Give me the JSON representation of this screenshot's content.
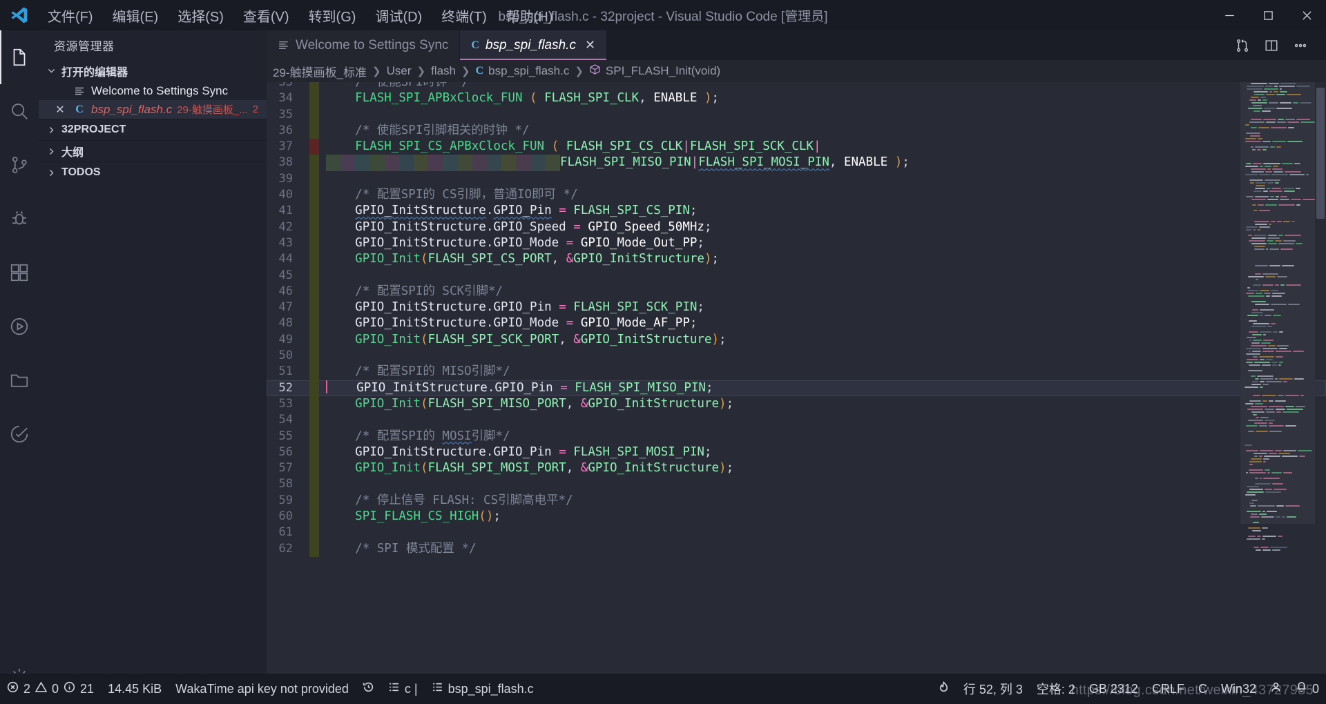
{
  "window": {
    "title": "bsp_spi_flash.c - 32project - Visual Studio Code [管理员]",
    "logo_icon": "vscode-logo",
    "minimize_icon": "minimize-icon",
    "maximize_icon": "maximize-icon",
    "close_icon": "close-icon"
  },
  "menubar": {
    "items": [
      {
        "label": "文件(F)"
      },
      {
        "label": "编辑(E)"
      },
      {
        "label": "选择(S)"
      },
      {
        "label": "查看(V)"
      },
      {
        "label": "转到(G)"
      },
      {
        "label": "调试(D)"
      },
      {
        "label": "终端(T)"
      },
      {
        "label": "帮助(H)"
      }
    ]
  },
  "activitybar": {
    "items": [
      {
        "name": "explorer",
        "icon": "files-icon",
        "active": true
      },
      {
        "name": "search",
        "icon": "search-icon",
        "active": false
      },
      {
        "name": "source-control",
        "icon": "source-control-icon",
        "active": false
      },
      {
        "name": "debug",
        "icon": "debug-icon",
        "active": false
      },
      {
        "name": "extensions",
        "icon": "extensions-icon",
        "active": false
      },
      {
        "name": "run",
        "icon": "play-circle-icon",
        "active": false
      },
      {
        "name": "remote",
        "icon": "folder-icon",
        "active": false
      },
      {
        "name": "testing",
        "icon": "beaker-icon",
        "active": false
      }
    ],
    "bottom": [
      {
        "name": "settings",
        "icon": "gear-icon",
        "active": false
      }
    ]
  },
  "sidebar": {
    "title": "资源管理器",
    "open_editors": {
      "label": "打开的编辑器",
      "expanded": true,
      "rows": [
        {
          "name": "Welcome to Settings Sync",
          "icon": "preview-icon",
          "description": "",
          "count": "",
          "selected": false,
          "dirty": false,
          "has_close": false
        },
        {
          "name": "bsp_spi_flash.c",
          "icon": "c-file-icon",
          "description": "29-触摸画板_...",
          "count": "2",
          "selected": true,
          "dirty": true,
          "has_close": true
        }
      ]
    },
    "sections": [
      {
        "label": "32PROJECT",
        "expanded": false
      },
      {
        "label": "大纲",
        "expanded": false
      },
      {
        "label": "TODOS",
        "expanded": false
      }
    ]
  },
  "tabs": [
    {
      "label": "Welcome to Settings Sync",
      "icon": "preview-icon",
      "active": false,
      "dirty": false,
      "closable": false
    },
    {
      "label": "bsp_spi_flash.c",
      "icon": "c-file-icon",
      "active": true,
      "dirty": true,
      "closable": true,
      "close_icon": "close-icon"
    }
  ],
  "tab_actions": [
    {
      "name": "split-diff",
      "icon": "compare-icon"
    },
    {
      "name": "split-editor",
      "icon": "split-editor-icon"
    },
    {
      "name": "more-actions",
      "icon": "ellipsis-icon"
    }
  ],
  "breadcrumbs": [
    {
      "label": "29-触摸画板_标准",
      "icon": ""
    },
    {
      "label": "User",
      "icon": ""
    },
    {
      "label": "flash",
      "icon": ""
    },
    {
      "label": "bsp_spi_flash.c",
      "icon": "c-file-icon"
    },
    {
      "label": "SPI_FLASH_Init(void)",
      "icon": "symbol-method-icon"
    }
  ],
  "editor": {
    "language": "c",
    "first_visible_line": 32,
    "cursor_line": 52,
    "lines": [
      {
        "num": 33,
        "deco": "line",
        "indent": 4,
        "tokens": [
          {
            "t": "/* 使能SPI时钟 */",
            "c": "cm"
          }
        ]
      },
      {
        "num": 34,
        "deco": "line",
        "indent": 4,
        "tokens": [
          {
            "t": "FLASH_SPI_APBxClock_FUN",
            "c": "fn"
          },
          {
            "t": " ",
            "c": "pn"
          },
          {
            "t": "(",
            "c": "br"
          },
          {
            "t": " ",
            "c": "pn"
          },
          {
            "t": "FLASH_SPI_CLK",
            "c": "id"
          },
          {
            "t": ",",
            "c": "pn"
          },
          {
            "t": " ",
            "c": "pn"
          },
          {
            "t": "ENABLE",
            "c": "kw"
          },
          {
            "t": " ",
            "c": "pn"
          },
          {
            "t": ")",
            "c": "br"
          },
          {
            "t": ";",
            "c": "pn"
          }
        ]
      },
      {
        "num": 35,
        "deco": "line",
        "indent": 0,
        "tokens": []
      },
      {
        "num": 36,
        "deco": "line",
        "indent": 4,
        "tokens": [
          {
            "t": "/* 使能SPI引脚相关的时钟 */",
            "c": "cm"
          }
        ]
      },
      {
        "num": 37,
        "deco": "err",
        "indent": 4,
        "tokens": [
          {
            "t": "FLASH_SPI_CS_APBxClock_FUN",
            "c": "fn"
          },
          {
            "t": " ",
            "c": "pn"
          },
          {
            "t": "(",
            "c": "br"
          },
          {
            "t": " ",
            "c": "pn"
          },
          {
            "t": "FLASH_SPI_CS_CLK",
            "c": "id"
          },
          {
            "t": "|",
            "c": "op"
          },
          {
            "t": "FLASH_SPI_SCK_CLK",
            "c": "id"
          },
          {
            "t": "|",
            "c": "op"
          }
        ]
      },
      {
        "num": 38,
        "deco": "line",
        "indent": 0,
        "rainbow": true,
        "tokens": [
          {
            "t": "FLASH_SPI_MISO_PIN",
            "c": "id"
          },
          {
            "t": "|",
            "c": "op"
          },
          {
            "t": "FLASH_SPI_MOSI_PIN",
            "c": "id squiggle"
          },
          {
            "t": ",",
            "c": "pn"
          },
          {
            "t": " ",
            "c": "pn"
          },
          {
            "t": "ENABLE",
            "c": "kw"
          },
          {
            "t": " ",
            "c": "pn"
          },
          {
            "t": ")",
            "c": "br"
          },
          {
            "t": ";",
            "c": "pn"
          }
        ]
      },
      {
        "num": 39,
        "deco": "line",
        "indent": 0,
        "tokens": []
      },
      {
        "num": 40,
        "deco": "line",
        "indent": 4,
        "tokens": [
          {
            "t": "/* 配置SPI的 CS引脚，普通IO即可 */",
            "c": "cm"
          }
        ]
      },
      {
        "num": 41,
        "deco": "line",
        "indent": 4,
        "tokens": [
          {
            "t": "GPIO_InitStructure",
            "c": "pr squiggle"
          },
          {
            "t": ".",
            "c": "pn"
          },
          {
            "t": "GPIO_Pin",
            "c": "pr squiggle"
          },
          {
            "t": " ",
            "c": "pn"
          },
          {
            "t": "=",
            "c": "op"
          },
          {
            "t": " ",
            "c": "pn"
          },
          {
            "t": "FLASH_SPI_CS_PIN",
            "c": "id"
          },
          {
            "t": ";",
            "c": "pn"
          }
        ]
      },
      {
        "num": 42,
        "deco": "line",
        "indent": 4,
        "tokens": [
          {
            "t": "GPIO_InitStructure",
            "c": "pr"
          },
          {
            "t": ".",
            "c": "pn"
          },
          {
            "t": "GPIO_Speed",
            "c": "pr"
          },
          {
            "t": " ",
            "c": "pn"
          },
          {
            "t": "=",
            "c": "op"
          },
          {
            "t": " ",
            "c": "pn"
          },
          {
            "t": "GPIO_Speed_50MHz",
            "c": "kw"
          },
          {
            "t": ";",
            "c": "pn"
          }
        ]
      },
      {
        "num": 43,
        "deco": "line",
        "indent": 4,
        "tokens": [
          {
            "t": "GPIO_InitStructure",
            "c": "pr"
          },
          {
            "t": ".",
            "c": "pn"
          },
          {
            "t": "GPIO_Mode",
            "c": "pr"
          },
          {
            "t": " ",
            "c": "pn"
          },
          {
            "t": "=",
            "c": "op"
          },
          {
            "t": " ",
            "c": "pn"
          },
          {
            "t": "GPIO_Mode_Out_PP",
            "c": "kw"
          },
          {
            "t": ";",
            "c": "pn"
          }
        ]
      },
      {
        "num": 44,
        "deco": "line",
        "indent": 4,
        "tokens": [
          {
            "t": "GPIO_Init",
            "c": "fn"
          },
          {
            "t": "(",
            "c": "br"
          },
          {
            "t": "FLASH_SPI_CS_PORT",
            "c": "id"
          },
          {
            "t": ",",
            "c": "pn"
          },
          {
            "t": " ",
            "c": "pn"
          },
          {
            "t": "&",
            "c": "amp"
          },
          {
            "t": "GPIO_InitStructure",
            "c": "id"
          },
          {
            "t": ")",
            "c": "br"
          },
          {
            "t": ";",
            "c": "pn"
          }
        ]
      },
      {
        "num": 45,
        "deco": "line",
        "indent": 0,
        "tokens": []
      },
      {
        "num": 46,
        "deco": "line",
        "indent": 4,
        "tokens": [
          {
            "t": "/* 配置SPI的 SCK引脚*/",
            "c": "cm"
          }
        ]
      },
      {
        "num": 47,
        "deco": "line",
        "indent": 4,
        "tokens": [
          {
            "t": "GPIO_InitStructure",
            "c": "pr"
          },
          {
            "t": ".",
            "c": "pn"
          },
          {
            "t": "GPIO_Pin",
            "c": "pr"
          },
          {
            "t": " ",
            "c": "pn"
          },
          {
            "t": "=",
            "c": "op"
          },
          {
            "t": " ",
            "c": "pn"
          },
          {
            "t": "FLASH_SPI_SCK_PIN",
            "c": "id"
          },
          {
            "t": ";",
            "c": "pn"
          }
        ]
      },
      {
        "num": 48,
        "deco": "line",
        "indent": 4,
        "tokens": [
          {
            "t": "GPIO_InitStructure",
            "c": "pr"
          },
          {
            "t": ".",
            "c": "pn"
          },
          {
            "t": "GPIO_Mode",
            "c": "pr"
          },
          {
            "t": " ",
            "c": "pn"
          },
          {
            "t": "=",
            "c": "op"
          },
          {
            "t": " ",
            "c": "pn"
          },
          {
            "t": "GPIO_Mode_AF_PP",
            "c": "kw"
          },
          {
            "t": ";",
            "c": "pn"
          }
        ]
      },
      {
        "num": 49,
        "deco": "line",
        "indent": 4,
        "tokens": [
          {
            "t": "GPIO_Init",
            "c": "fn"
          },
          {
            "t": "(",
            "c": "br"
          },
          {
            "t": "FLASH_SPI_SCK_PORT",
            "c": "id"
          },
          {
            "t": ",",
            "c": "pn"
          },
          {
            "t": " ",
            "c": "pn"
          },
          {
            "t": "&",
            "c": "amp"
          },
          {
            "t": "GPIO_InitStructure",
            "c": "id"
          },
          {
            "t": ")",
            "c": "br"
          },
          {
            "t": ";",
            "c": "pn"
          }
        ]
      },
      {
        "num": 50,
        "deco": "line",
        "indent": 0,
        "tokens": []
      },
      {
        "num": 51,
        "deco": "line",
        "indent": 4,
        "tokens": [
          {
            "t": "/* 配置SPI的 MISO引脚*/",
            "c": "cm"
          }
        ]
      },
      {
        "num": 52,
        "deco": "line",
        "indent": 4,
        "current": true,
        "tokens": [
          {
            "t": "GPIO_InitStructure",
            "c": "pr"
          },
          {
            "t": ".",
            "c": "pn"
          },
          {
            "t": "GPIO_Pin",
            "c": "pr"
          },
          {
            "t": " ",
            "c": "pn"
          },
          {
            "t": "=",
            "c": "op"
          },
          {
            "t": " ",
            "c": "pn"
          },
          {
            "t": "FLASH_SPI_MISO_PIN",
            "c": "id"
          },
          {
            "t": ";",
            "c": "pn"
          }
        ]
      },
      {
        "num": 53,
        "deco": "line",
        "indent": 4,
        "tokens": [
          {
            "t": "GPIO_Init",
            "c": "fn"
          },
          {
            "t": "(",
            "c": "br"
          },
          {
            "t": "FLASH_SPI_MISO_PORT",
            "c": "id"
          },
          {
            "t": ",",
            "c": "pn"
          },
          {
            "t": " ",
            "c": "pn"
          },
          {
            "t": "&",
            "c": "amp"
          },
          {
            "t": "GPIO_InitStructure",
            "c": "id"
          },
          {
            "t": ")",
            "c": "br"
          },
          {
            "t": ";",
            "c": "pn"
          }
        ]
      },
      {
        "num": 54,
        "deco": "line",
        "indent": 0,
        "tokens": []
      },
      {
        "num": 55,
        "deco": "line",
        "indent": 4,
        "tokens": [
          {
            "t": "/* 配置SPI的 ",
            "c": "cm"
          },
          {
            "t": "MOSI",
            "c": "cm squiggle"
          },
          {
            "t": "引脚*/",
            "c": "cm"
          }
        ]
      },
      {
        "num": 56,
        "deco": "line",
        "indent": 4,
        "tokens": [
          {
            "t": "GPIO_InitStructure",
            "c": "pr"
          },
          {
            "t": ".",
            "c": "pn"
          },
          {
            "t": "GPIO_Pin",
            "c": "pr"
          },
          {
            "t": " ",
            "c": "pn"
          },
          {
            "t": "=",
            "c": "op"
          },
          {
            "t": " ",
            "c": "pn"
          },
          {
            "t": "FLASH_SPI_MOSI_PIN",
            "c": "id"
          },
          {
            "t": ";",
            "c": "pn"
          }
        ]
      },
      {
        "num": 57,
        "deco": "line",
        "indent": 4,
        "tokens": [
          {
            "t": "GPIO_Init",
            "c": "fn"
          },
          {
            "t": "(",
            "c": "br"
          },
          {
            "t": "FLASH_SPI_MOSI_PORT",
            "c": "id"
          },
          {
            "t": ",",
            "c": "pn"
          },
          {
            "t": " ",
            "c": "pn"
          },
          {
            "t": "&",
            "c": "amp"
          },
          {
            "t": "GPIO_InitStructure",
            "c": "id"
          },
          {
            "t": ")",
            "c": "br"
          },
          {
            "t": ";",
            "c": "pn"
          }
        ]
      },
      {
        "num": 58,
        "deco": "line",
        "indent": 0,
        "tokens": []
      },
      {
        "num": 59,
        "deco": "line",
        "indent": 4,
        "tokens": [
          {
            "t": "/* 停止信号 FLASH: CS引脚高电平*/",
            "c": "cm"
          }
        ]
      },
      {
        "num": 60,
        "deco": "line",
        "indent": 4,
        "tokens": [
          {
            "t": "SPI_FLASH_CS_HIGH",
            "c": "fn"
          },
          {
            "t": "(",
            "c": "br"
          },
          {
            "t": ")",
            "c": "br"
          },
          {
            "t": ";",
            "c": "pn"
          }
        ]
      },
      {
        "num": 61,
        "deco": "line",
        "indent": 0,
        "tokens": []
      },
      {
        "num": 62,
        "deco": "line",
        "indent": 4,
        "tokens": [
          {
            "t": "/* SPI 模式配置 */",
            "c": "cm"
          }
        ]
      }
    ]
  },
  "statusbar": {
    "left": [
      {
        "name": "errors-warnings",
        "icon": "error-icon",
        "label": "2",
        "icon2": "warning-icon",
        "label2": "0",
        "icon3": "info-icon",
        "label3": "21"
      },
      {
        "name": "file-size",
        "label": "14.45 KiB"
      },
      {
        "name": "wakatime",
        "label": "WakaTime api key not provided"
      },
      {
        "name": "history",
        "icon": "history-icon",
        "label": ""
      },
      {
        "name": "outline-lang",
        "icon": "list-icon",
        "label": "c |"
      },
      {
        "name": "outline-file",
        "icon": "list-icon",
        "label": "bsp_spi_flash.c"
      }
    ],
    "right": [
      {
        "name": "power-mode",
        "icon": "flame-icon",
        "label": ""
      },
      {
        "name": "cursor-position",
        "label": "行 52, 列 3"
      },
      {
        "name": "indentation",
        "label": "空格: 2"
      },
      {
        "name": "encoding",
        "label": "GB 2312"
      },
      {
        "name": "eol",
        "label": "CRLF"
      },
      {
        "name": "language-mode",
        "label": "C"
      },
      {
        "name": "platform",
        "label": "Win32"
      },
      {
        "name": "accounts",
        "icon": "account-icon",
        "label": ""
      },
      {
        "name": "notifications",
        "icon": "bell-icon",
        "label": "0"
      }
    ]
  },
  "watermark": "https://blog.csdn.net/weixin_43727985",
  "colors": {
    "accent": "#b07aad",
    "error": "#c9524e",
    "background": "#282a36",
    "chrome": "#20222e",
    "titlebar": "#191b24"
  }
}
